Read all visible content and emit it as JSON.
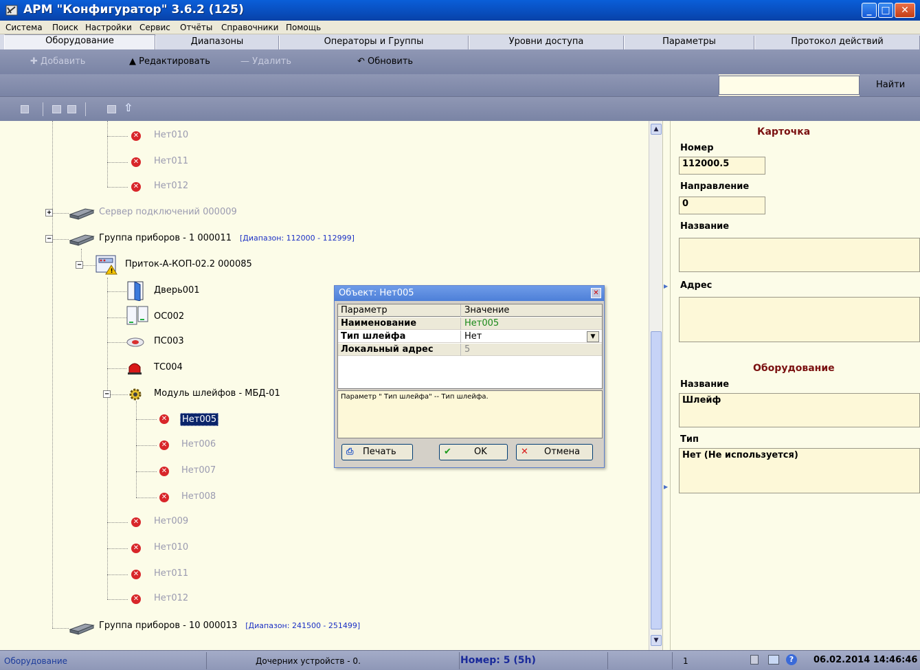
{
  "window": {
    "title": "АРМ \"Конфигуратор\"  3.6.2 (125)"
  },
  "menu": [
    "Система",
    "Поиск",
    "Настройки",
    "Сервис",
    "Отчёты",
    "Справочники",
    "Помощь"
  ],
  "tabs": [
    "Оборудование",
    "Диапазоны",
    "Операторы и Группы",
    "Уровни доступа",
    "Параметры",
    "Протокол действий"
  ],
  "toolbar": {
    "add": "Добавить",
    "edit": "Редактировать",
    "delete": "Удалить",
    "refresh": "Обновить",
    "find": "Найти",
    "search_value": ""
  },
  "tree": {
    "n010a": "Нет010",
    "n011a": "Нет011",
    "n012a": "Нет012",
    "server": "Сервер подключений 000009",
    "group1": "Группа приборов - 1 000011",
    "group1_range": "[Диапазон: 112000 - 112999]",
    "device": "Приток-А-КОП-02.2 000085",
    "door": "Дверь001",
    "oc": "ОС002",
    "pc": "ПС003",
    "tc": "ТС004",
    "module": "Модуль шлейфов - МБД-01",
    "n005": "Нет005",
    "n006": "Нет006",
    "n007": "Нет007",
    "n008": "Нет008",
    "n009": "Нет009",
    "n010b": "Нет010",
    "n011b": "Нет011",
    "n012b": "Нет012",
    "group10": "Группа приборов - 10 000013",
    "group10_range": "[Диапазон: 241500 - 251499]"
  },
  "card": {
    "heading": "Карточка",
    "number_label": "Номер",
    "number": "112000.5",
    "direction_label": "Направление",
    "direction": "0",
    "name_label": "Название",
    "name": "",
    "address_label": "Адрес",
    "address": "",
    "equipment_heading": "Оборудование",
    "eq_name_label": "Название",
    "eq_name": "Шлейф",
    "type_label": "Тип",
    "type": "Нет (Не используется)"
  },
  "dialog": {
    "title": "Объект: Нет005",
    "col_param": "Параметр",
    "col_value": "Значение",
    "rows": [
      {
        "param": "Наименование",
        "value": "Нет005"
      },
      {
        "param": "Тип шлейфа",
        "value": "Нет"
      },
      {
        "param": "Локальный адрес",
        "value": "5"
      }
    ],
    "description": "Параметр \" Тип шлейфа\" -- Тип шлейфа.",
    "print": "Печать",
    "ok": "OK",
    "cancel": "Отмена"
  },
  "status": {
    "section": "Оборудование",
    "children": "Дочерних устройств - 0.",
    "number": "Номер: 5 (5h)",
    "count": "1",
    "datetime": "06.02.2014 14:46:46"
  }
}
